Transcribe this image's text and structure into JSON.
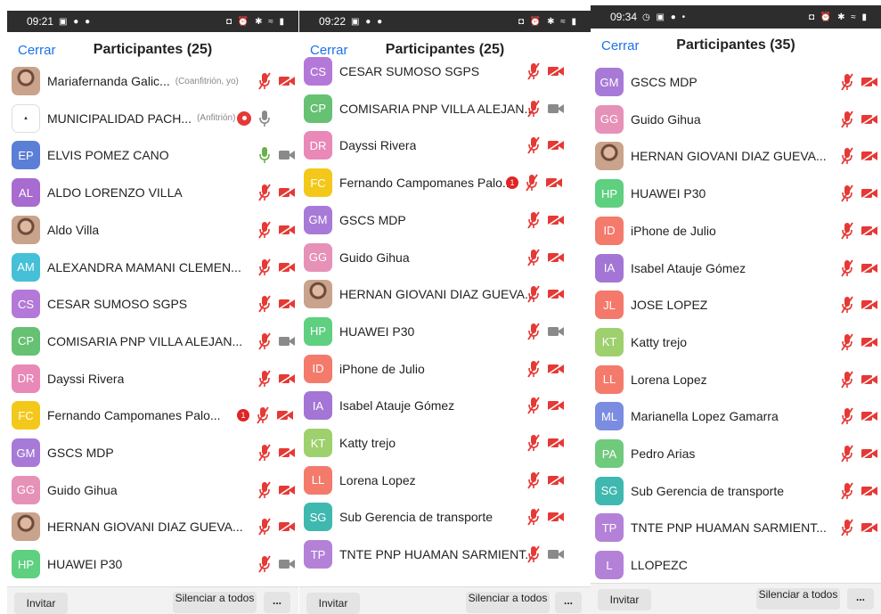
{
  "colors": {
    "link": "#1a73e8",
    "mic_off": "#e53935",
    "mic_on": "#6ab04c",
    "muted_grey": "#8a8a8a",
    "avatars": {
      "EP": "#5b7ed6",
      "AL": "#a86bd0",
      "AM": "#45c0d6",
      "CS": "#b479d8",
      "CP": "#66c173",
      "DR": "#e989b8",
      "FC": "#f3c81a",
      "GM": "#a77ad8",
      "GG": "#e691b8",
      "HP": "#5ed080",
      "ID": "#f47a6c",
      "IA": "#a375d5",
      "KT": "#9ed06e",
      "LL": "#f47a6c",
      "SG": "#3fb8b0",
      "TP": "#b481d8",
      "JL": "#f4796a",
      "ML": "#7b8de0",
      "PA": "#6fca7c",
      "L": "#b481d8"
    }
  },
  "panels": [
    {
      "status": {
        "time": "09:21",
        "left_icons": "▣ ● ●",
        "right_icons": "◘ ⏰ ✱ ≈ ▮"
      },
      "header": {
        "close": "Cerrar",
        "title": "Participantes (25)"
      },
      "participants": [
        {
          "initials": "",
          "avatar": "photo",
          "name": "Mariafernanda Galic...",
          "role": "(Coanfitrión, yo)",
          "mic": "off",
          "cam": "off"
        },
        {
          "initials": "",
          "avatar": "logo",
          "name": "MUNICIPALIDAD PACH...",
          "role": "(Anfitrión)",
          "mic": "muted",
          "cam": "none",
          "rec": true
        },
        {
          "initials": "EP",
          "name": "ELVIS POMEZ CANO",
          "mic": "on",
          "cam": "grey"
        },
        {
          "initials": "AL",
          "name": "ALDO LORENZO VILLA",
          "mic": "off",
          "cam": "off"
        },
        {
          "initials": "",
          "avatar": "photo",
          "name": "Aldo Villa",
          "mic": "off",
          "cam": "off"
        },
        {
          "initials": "AM",
          "name": "ALEXANDRA MAMANI CLEMEN...",
          "mic": "off",
          "cam": "off"
        },
        {
          "initials": "CS",
          "name": "CESAR SUMOSO SGPS",
          "mic": "off",
          "cam": "off"
        },
        {
          "initials": "CP",
          "name": "COMISARIA PNP VILLA ALEJAN...",
          "mic": "off",
          "cam": "grey"
        },
        {
          "initials": "DR",
          "name": "Dayssi Rivera",
          "mic": "off",
          "cam": "off"
        },
        {
          "initials": "FC",
          "name": "Fernando Campomanes Palo...",
          "mic": "off",
          "cam": "off",
          "badge": "1"
        },
        {
          "initials": "GM",
          "name": "GSCS MDP",
          "mic": "off",
          "cam": "off"
        },
        {
          "initials": "GG",
          "name": "Guido Gihua",
          "mic": "off",
          "cam": "off"
        },
        {
          "initials": "",
          "avatar": "photo",
          "name": "HERNAN GIOVANI DIAZ GUEVA...",
          "mic": "off",
          "cam": "off"
        },
        {
          "initials": "HP",
          "name": "HUAWEI P30",
          "mic": "off",
          "cam": "grey"
        }
      ],
      "toolbar": {
        "invite": "Invitar",
        "mute_all": "Silenciar a todos",
        "more": "..."
      }
    },
    {
      "status": {
        "time": "09:22",
        "left_icons": "▣ ● ●",
        "right_icons": "◘ ⏰ ✱ ≈ ▮"
      },
      "header": {
        "close": "Cerrar",
        "title": "Participantes (25)"
      },
      "participants": [
        {
          "initials": "CS",
          "name": "CESAR SUMOSO SGPS",
          "mic": "off",
          "cam": "off"
        },
        {
          "initials": "CP",
          "name": "COMISARIA PNP VILLA ALEJAN...",
          "mic": "off",
          "cam": "grey"
        },
        {
          "initials": "DR",
          "name": "Dayssi Rivera",
          "mic": "off",
          "cam": "off"
        },
        {
          "initials": "FC",
          "name": "Fernando Campomanes Palo...",
          "mic": "off",
          "cam": "off",
          "badge": "1"
        },
        {
          "initials": "GM",
          "name": "GSCS MDP",
          "mic": "off",
          "cam": "off"
        },
        {
          "initials": "GG",
          "name": "Guido Gihua",
          "mic": "off",
          "cam": "off"
        },
        {
          "initials": "",
          "avatar": "photo",
          "name": "HERNAN GIOVANI DIAZ GUEVA...",
          "mic": "off",
          "cam": "off"
        },
        {
          "initials": "HP",
          "name": "HUAWEI P30",
          "mic": "off",
          "cam": "grey"
        },
        {
          "initials": "ID",
          "name": "iPhone de Julio",
          "mic": "off",
          "cam": "off"
        },
        {
          "initials": "IA",
          "name": "Isabel Atauje Gómez",
          "mic": "off",
          "cam": "off"
        },
        {
          "initials": "KT",
          "name": "Katty trejo",
          "mic": "off",
          "cam": "off"
        },
        {
          "initials": "LL",
          "name": "Lorena Lopez",
          "mic": "off",
          "cam": "off"
        },
        {
          "initials": "SG",
          "name": "Sub Gerencia de transporte",
          "mic": "off",
          "cam": "off"
        },
        {
          "initials": "TP",
          "name": "TNTE PNP HUAMAN SARMIENT...",
          "mic": "off",
          "cam": "grey"
        }
      ],
      "toolbar": {
        "invite": "Invitar",
        "mute_all": "Silenciar a todos",
        "more": "..."
      }
    },
    {
      "status": {
        "time": "09:34",
        "left_icons": "◷ ▣ ● •",
        "right_icons": "◘ ⏰ ✱ ≈ ▮"
      },
      "header": {
        "close": "Cerrar",
        "title": "Participantes (35)"
      },
      "participants": [
        {
          "initials": "GM",
          "name": "GSCS MDP",
          "mic": "off",
          "cam": "off"
        },
        {
          "initials": "GG",
          "name": "Guido Gihua",
          "mic": "off",
          "cam": "off"
        },
        {
          "initials": "",
          "avatar": "photo",
          "name": "HERNAN GIOVANI DIAZ GUEVA...",
          "mic": "off",
          "cam": "off"
        },
        {
          "initials": "HP",
          "name": "HUAWEI P30",
          "mic": "off",
          "cam": "off"
        },
        {
          "initials": "ID",
          "name": "iPhone de Julio",
          "mic": "off",
          "cam": "off"
        },
        {
          "initials": "IA",
          "name": "Isabel Atauje Gómez",
          "mic": "off",
          "cam": "off"
        },
        {
          "initials": "JL",
          "name": "JOSE LOPEZ",
          "mic": "off",
          "cam": "off"
        },
        {
          "initials": "KT",
          "name": "Katty trejo",
          "mic": "off",
          "cam": "off"
        },
        {
          "initials": "LL",
          "name": "Lorena Lopez",
          "mic": "off",
          "cam": "off"
        },
        {
          "initials": "ML",
          "name": "Marianella Lopez Gamarra",
          "mic": "off",
          "cam": "off"
        },
        {
          "initials": "PA",
          "name": "Pedro Arias",
          "mic": "off",
          "cam": "off"
        },
        {
          "initials": "SG",
          "name": "Sub Gerencia de transporte",
          "mic": "off",
          "cam": "off"
        },
        {
          "initials": "TP",
          "name": "TNTE PNP HUAMAN SARMIENT...",
          "mic": "off",
          "cam": "off"
        },
        {
          "initials": "L",
          "name": "LLOPEZC",
          "mic": "none",
          "cam": "none"
        }
      ],
      "toolbar": {
        "invite": "Invitar",
        "mute_all": "Silenciar a todos",
        "more": "..."
      }
    }
  ]
}
